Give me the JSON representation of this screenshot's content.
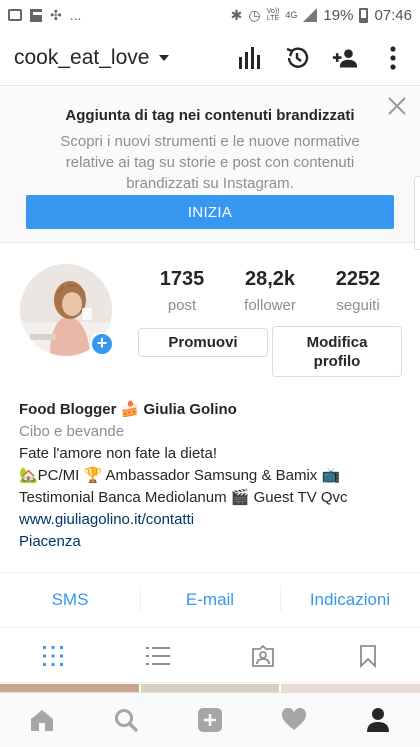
{
  "status_bar": {
    "ellipsis": "...",
    "network_top": "Vo))",
    "network_bottom": "LTE",
    "network_type": "4G",
    "battery": "19%",
    "time": "07:46"
  },
  "header": {
    "username": "cook_eat_love",
    "icons": [
      "insights-icon",
      "history-icon",
      "add-person-icon",
      "more-vertical-icon"
    ]
  },
  "banner": {
    "title": "Aggiunta di tag nei contenuti brandizzati",
    "text": "Scopri i nuovi strumenti e le nuove normative relative ai tag su storie e post con contenuti brandizzati su Instagram.",
    "button": "INIZIA"
  },
  "profile": {
    "stats": [
      {
        "value": "1735",
        "label": "post"
      },
      {
        "value": "28,2k",
        "label": "follower"
      },
      {
        "value": "2252",
        "label": "seguiti"
      }
    ],
    "promote_button": "Promuovi",
    "edit_button": "Modifica profilo"
  },
  "bio": {
    "name": "Food Blogger 🍰 Giulia Golino",
    "category": "Cibo e bevande",
    "line1": "Fate l'amore non fate la dieta!",
    "line2": "🏡PC/MI 🏆 Ambassador Samsung & Bamix 📺",
    "line3": "Testimonial Banca Mediolanum 🎬 Guest TV Qvc",
    "link": "www.giuliagolino.it/contatti",
    "location": "Piacenza"
  },
  "contact": {
    "sms": "SMS",
    "email": "E-mail",
    "directions": "Indicazioni"
  },
  "colors": {
    "accent": "#3897f0",
    "link": "#003569",
    "muted": "#8e8e8e"
  }
}
